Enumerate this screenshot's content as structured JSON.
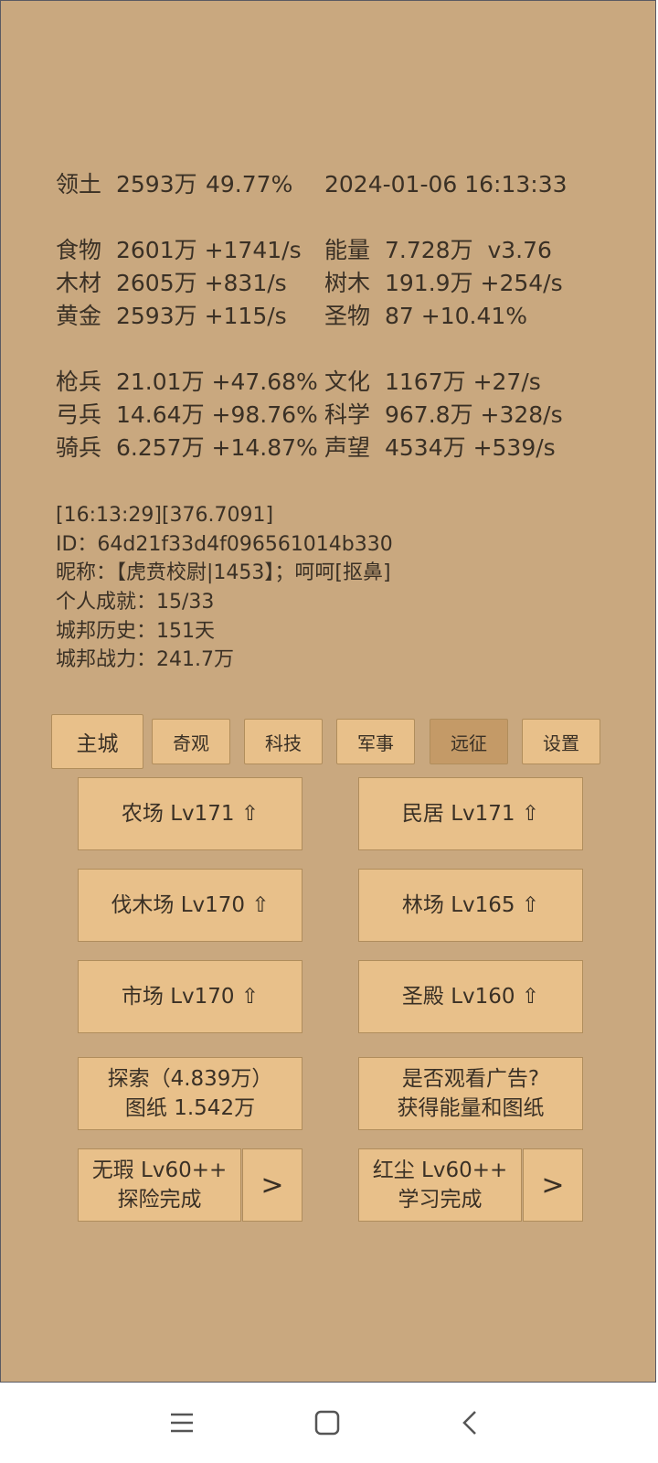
{
  "header": {
    "territory_label": "领土",
    "territory_value": "2593万",
    "territory_percent": "49.77%",
    "datetime": "2024-01-06 16:13:33"
  },
  "resources": {
    "food": {
      "label": "食物",
      "value": "2601万 +1741/s"
    },
    "energy": {
      "label": "能量",
      "value": "7.728万  v3.76"
    },
    "wood": {
      "label": "木材",
      "value": "2605万 +831/s"
    },
    "tree": {
      "label": "树木",
      "value": "191.9万 +254/s"
    },
    "gold": {
      "label": "黄金",
      "value": "2593万 +115/s"
    },
    "relic": {
      "label": "圣物",
      "value": "87 +10.41%"
    }
  },
  "military": {
    "spearman": {
      "label": "枪兵",
      "value": "21.01万 +47.68%"
    },
    "culture": {
      "label": "文化",
      "value": "1167万 +27/s"
    },
    "archer": {
      "label": "弓兵",
      "value": "14.64万 +98.76%"
    },
    "science": {
      "label": "科学",
      "value": "967.8万 +328/s"
    },
    "cavalry": {
      "label": "骑兵",
      "value": "6.257万 +14.87%"
    },
    "prestige": {
      "label": "声望",
      "value": "4534万 +539/s"
    }
  },
  "info": {
    "log": "[16:13:29][376.7091]",
    "id": "ID：64d21f33d4f096561014b330",
    "nickname": "昵称：【虎贲校尉|1453】；呵呵[抠鼻]",
    "achievements": "个人成就：15/33",
    "history": "城邦历史：151天",
    "power": "城邦战力：241.7万"
  },
  "tabs": {
    "main_city": "主城",
    "wonders": "奇观",
    "tech": "科技",
    "military": "军事",
    "expedition": "远征",
    "settings": "设置"
  },
  "buildings": {
    "farm": "农场 Lv171 ⇧",
    "house": "民居 Lv171 ⇧",
    "lumber": "伐木场 Lv170 ⇧",
    "forest": "林场 Lv165 ⇧",
    "market": "市场 Lv170 ⇧",
    "temple": "圣殿 Lv160 ⇧"
  },
  "explore": {
    "line1": "探索（4.839万）",
    "line2": "图纸 1.542万"
  },
  "ad": {
    "line1": "是否观看广告?",
    "line2": "获得能量和图纸"
  },
  "hero1": {
    "line1": "无瑕 Lv60++",
    "line2": "探险完成",
    "arrow": ">"
  },
  "hero2": {
    "line1": "红尘 Lv60++",
    "line2": "学习完成",
    "arrow": ">"
  },
  "icons": {
    "nav_menu": "menu-icon",
    "nav_home": "home-icon",
    "nav_back": "back-icon"
  }
}
